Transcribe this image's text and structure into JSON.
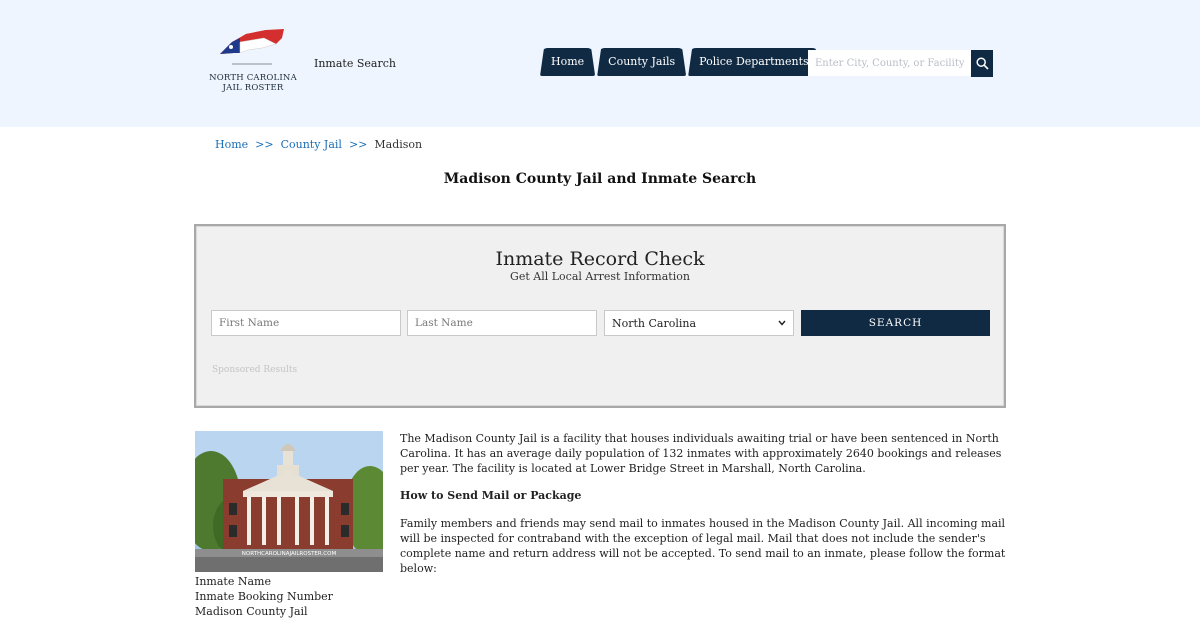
{
  "header": {
    "logo_lines": [
      "NORTH CAROLINA",
      "JAIL ROSTER"
    ],
    "site_name": "Inmate Search",
    "nav": [
      "Home",
      "County Jails",
      "Police Departments"
    ],
    "search_placeholder": "Enter City, County, or Facility",
    "search_icon": "magnifier-icon"
  },
  "breadcrumb": {
    "items": [
      "Home",
      "County Jail",
      "Madison"
    ],
    "separator": ">>"
  },
  "page_title": "Madison County Jail and Inmate Search",
  "record_check": {
    "title": "Inmate Record Check",
    "subtitle": "Get All Local Arrest Information",
    "first_name_placeholder": "First Name",
    "last_name_placeholder": "Last Name",
    "state_selected": "North Carolina",
    "search_label": "SEARCH",
    "sponsored": "Sponsored Results"
  },
  "photo": {
    "watermark": "NORTHCAROLINAJAILROSTER.COM"
  },
  "caption": [
    "Inmate Name",
    "Inmate Booking Number",
    "Madison County Jail"
  ],
  "content": {
    "intro": "The Madison County Jail is a facility that houses individuals awaiting trial or have been sentenced in North Carolina. It has an average daily population of 132 inmates with approximately 2640 bookings and releases per year. The facility is located at Lower Bridge Street in Marshall, North Carolina.",
    "mail_heading": "How to Send Mail or Package",
    "mail_text": "Family members and friends may send mail to inmates housed in the Madison County Jail. All incoming mail will be inspected for contraband with the exception of legal mail. Mail that does not include the sender's complete name and return address will not be accepted. To send mail to an inmate, please follow the format below:"
  },
  "colors": {
    "header_bg": "#eef5fe",
    "navy": "#102a43",
    "link": "#1a6fb5"
  }
}
